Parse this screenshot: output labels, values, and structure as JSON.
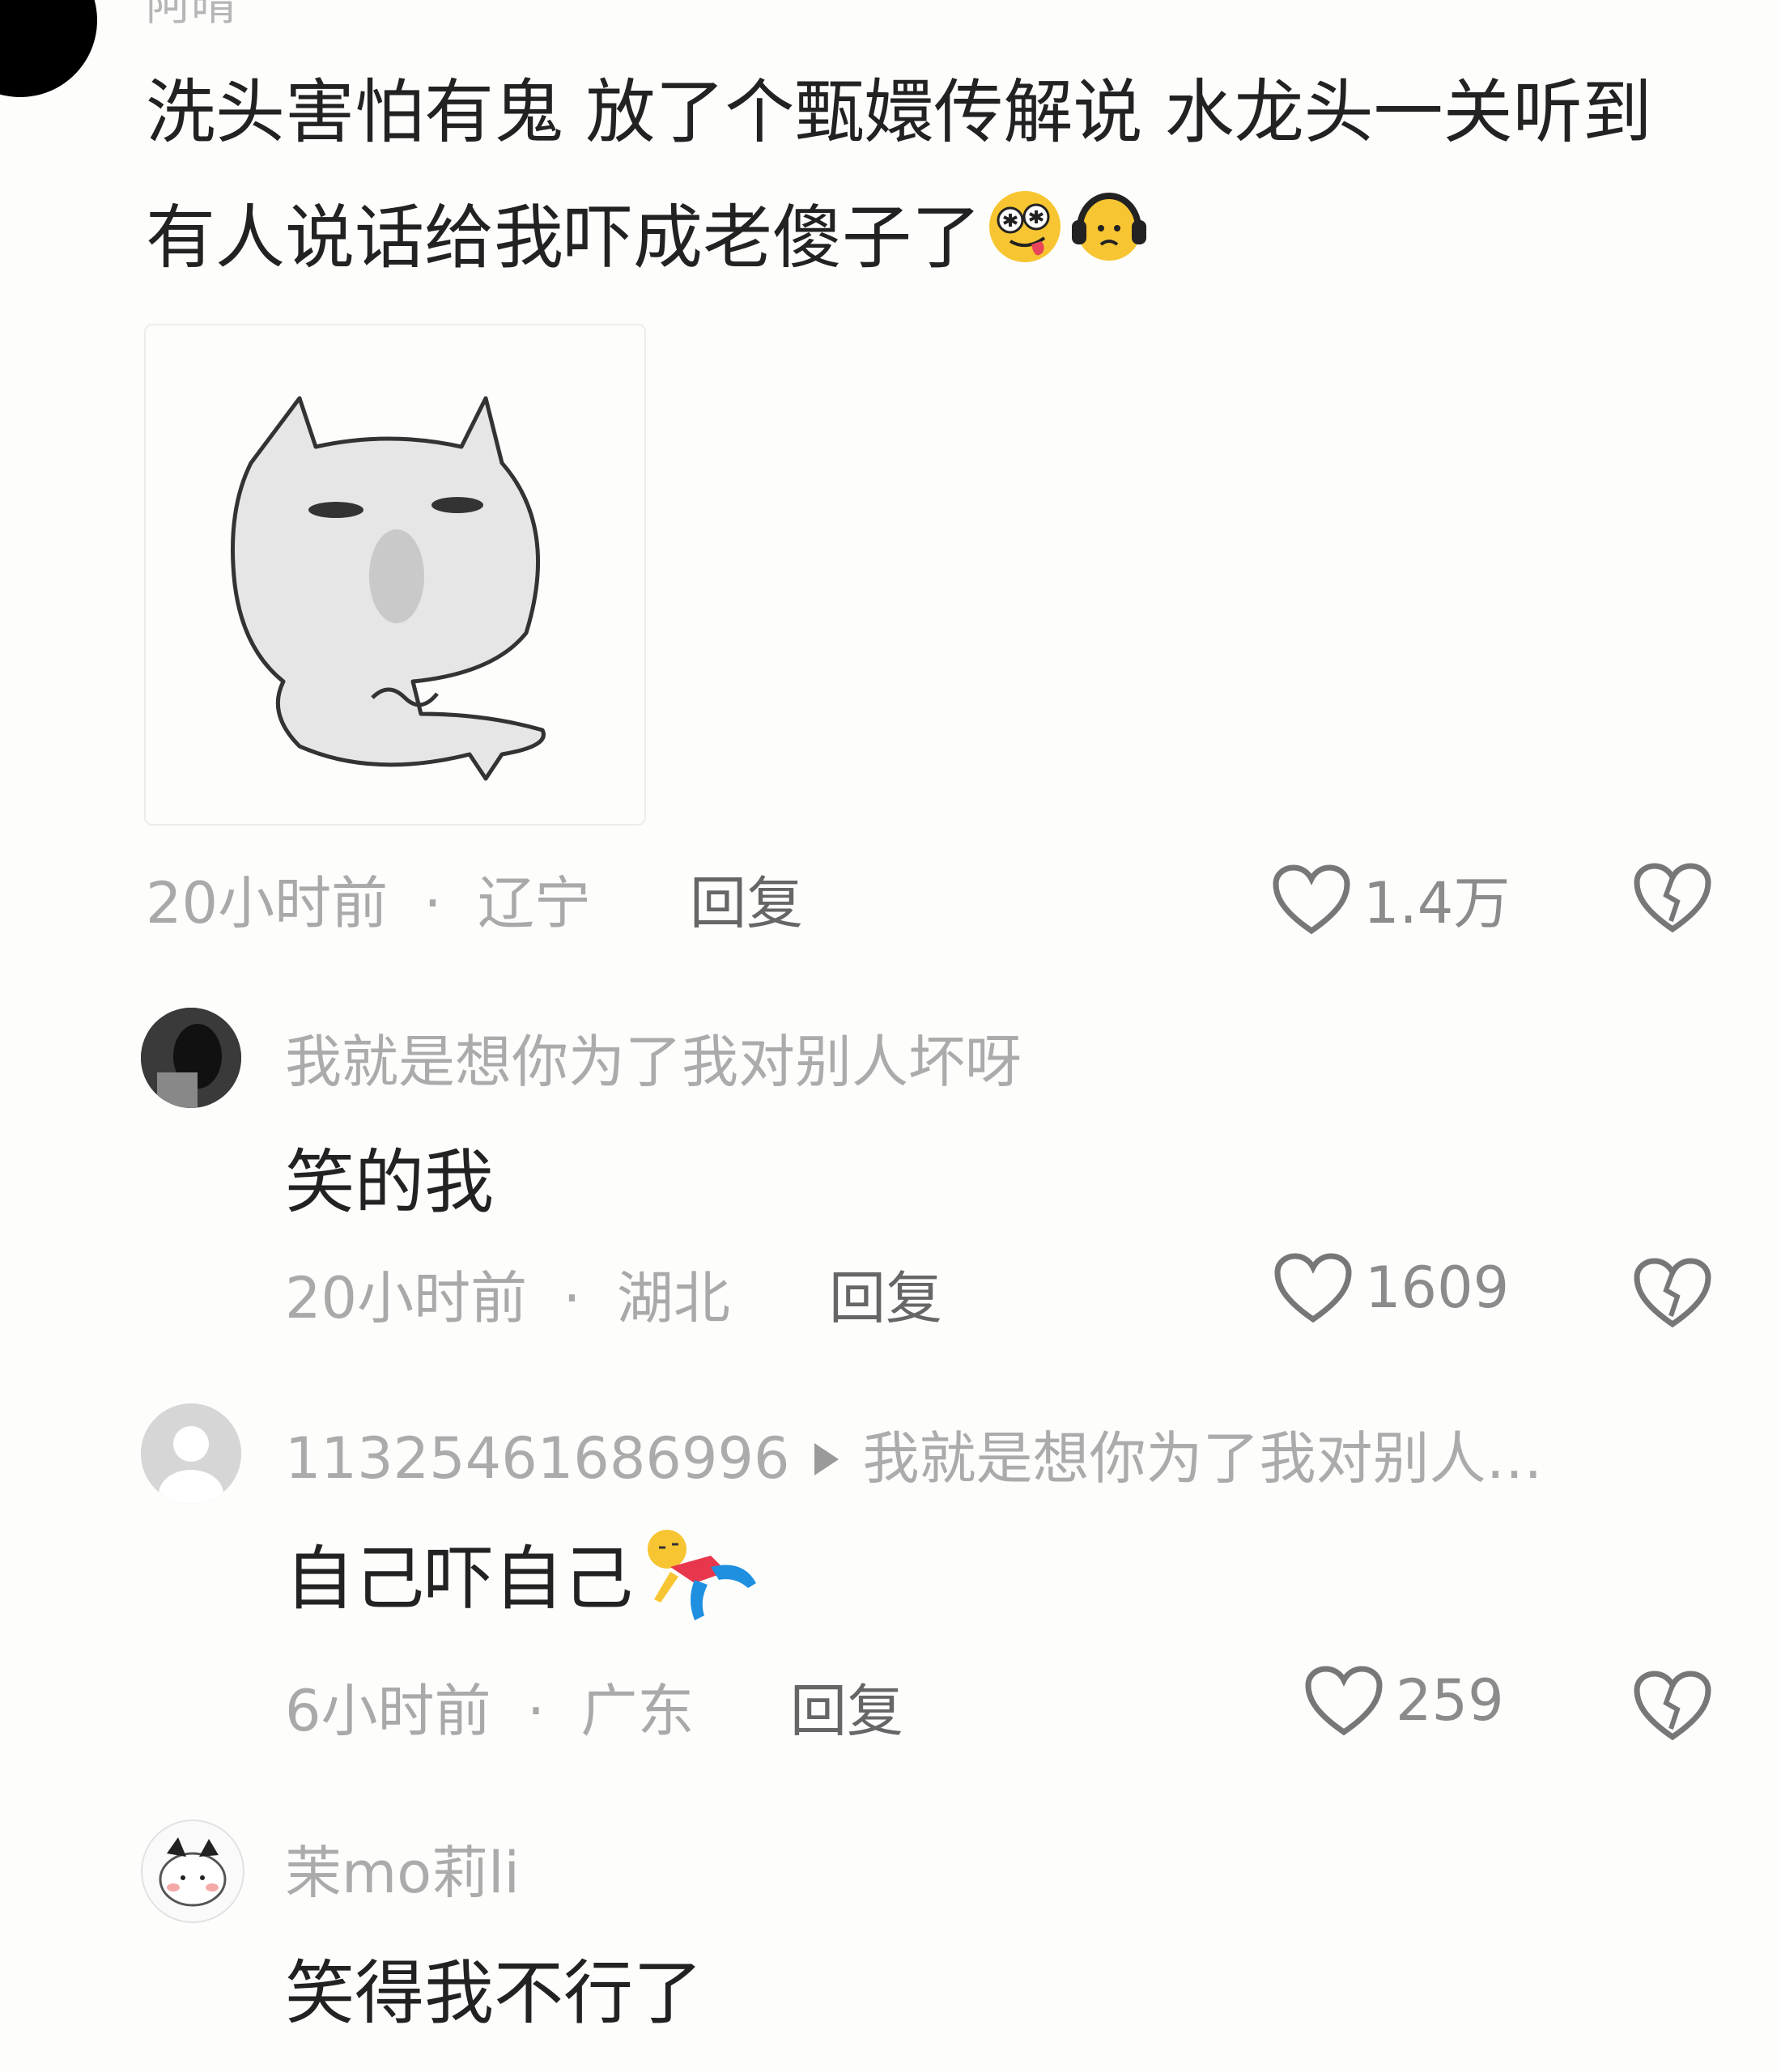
{
  "header": {
    "partial_name": "阿晴"
  },
  "main_comment": {
    "text": "洗头害怕有鬼 放了个甄嬛传解说 水龙头一关听到有人说话给我吓成老傻子了",
    "emoji_1": "dizzy-tongue-face-icon",
    "emoji_2": "headphones-face-icon",
    "time": "20小时前",
    "sep": "·",
    "location": "辽宁",
    "reply_label": "回复",
    "likes": "1.4万"
  },
  "replies": [
    {
      "username": "我就是想你为了我对别人坏呀",
      "text": "笑的我",
      "time": "20小时前",
      "sep": "·",
      "location": "湖北",
      "reply_label": "回复",
      "likes": "1609"
    },
    {
      "username": "11325461686996",
      "reply_to": "我就是想你为了我对别人…",
      "text": "自己吓自己",
      "emoji": "falling-person-icon",
      "time": "6小时前",
      "sep": "·",
      "location": "广东",
      "reply_label": "回复",
      "likes": "259"
    },
    {
      "username": "茉mo莉li",
      "text": "笑得我不行了"
    }
  ],
  "colors": {
    "text_main": "#222222",
    "text_muted": "#a9a9a9",
    "background": "#fdfdfc"
  }
}
